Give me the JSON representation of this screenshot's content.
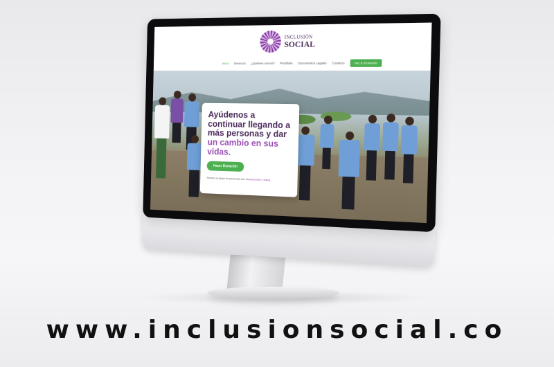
{
  "site": {
    "logo": {
      "top": "INCLUSIÓN",
      "main": "SOCIAL",
      "sub": ""
    },
    "nav": {
      "items": [
        "Inicio",
        "Servicios",
        "¿Quiénes somos?",
        "Portafolio",
        "Documentos Legales",
        "Contacto"
      ],
      "cta": "Haz tu Donación"
    },
    "hero": {
      "heading_line1": "Ayúdenos a continuar llegando a más personas y dar ",
      "heading_accent": "un cambio en sus vidas.",
      "button": "Hacer Donación",
      "small_text": "Somos un grupo de personas con ",
      "small_link": "discapacidad y trabaj..."
    }
  },
  "footer_url": "www.inclusionsocial.co",
  "colors": {
    "purple_dark": "#4a2a5a",
    "purple_accent": "#9b4fb6",
    "green": "#4caf50"
  }
}
